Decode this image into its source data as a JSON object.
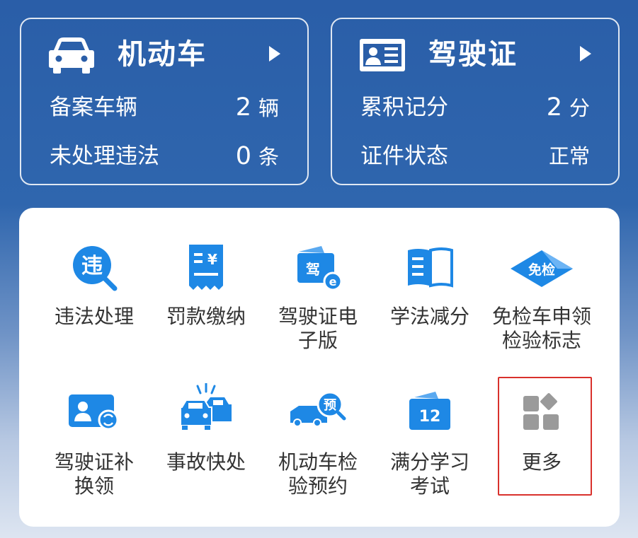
{
  "vehicle_card": {
    "title": "机动车",
    "icon": "car-icon",
    "rows": [
      {
        "label": "备案车辆",
        "value": "2",
        "unit": "辆"
      },
      {
        "label": "未处理违法",
        "value": "0",
        "unit": "条"
      }
    ]
  },
  "license_card": {
    "title": "驾驶证",
    "icon": "id-card-icon",
    "rows": [
      {
        "label": "累积记分",
        "value": "2",
        "unit": "分"
      },
      {
        "label": "证件状态",
        "value": "正常",
        "unit": ""
      }
    ]
  },
  "functions": [
    {
      "line1": "违法处理",
      "line2": "",
      "icon": "violation-magnifier-icon",
      "icon_text": "违"
    },
    {
      "line1": "罚款缴纳",
      "line2": "",
      "icon": "receipt-yuan-icon",
      "icon_text": "¥"
    },
    {
      "line1": "驾驶证电",
      "line2": "子版",
      "icon": "e-license-icon",
      "icon_text": "驾"
    },
    {
      "line1": "学法减分",
      "line2": "",
      "icon": "open-book-icon",
      "icon_text": ""
    },
    {
      "line1": "免检车申领",
      "line2": "检验标志",
      "icon": "exempt-diamond-icon",
      "icon_text": "免检"
    },
    {
      "line1": "驾驶证补",
      "line2": "换领",
      "icon": "license-reissue-icon",
      "icon_text": ""
    },
    {
      "line1": "事故快处",
      "line2": "",
      "icon": "accident-cars-icon",
      "icon_text": ""
    },
    {
      "line1": "机动车检",
      "line2": "验预约",
      "icon": "truck-appointment-icon",
      "icon_text": "预"
    },
    {
      "line1": "满分学习",
      "line2": "考试",
      "icon": "calendar-12-icon",
      "icon_text": "12"
    },
    {
      "line1": "更多",
      "line2": "",
      "icon": "more-grid-icon",
      "icon_text": ""
    }
  ],
  "colors": {
    "accent_blue": "#1e88e5",
    "highlight_red": "#d9312c",
    "header_blue": "#2a5ea8"
  }
}
